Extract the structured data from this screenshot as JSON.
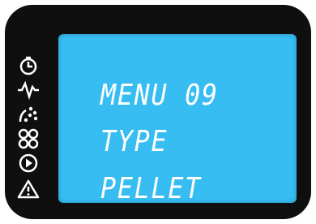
{
  "display": {
    "lines": [
      "MENU 09",
      "TYPE",
      "PELLET"
    ]
  },
  "icons": [
    {
      "name": "clock-icon"
    },
    {
      "name": "heater-icon"
    },
    {
      "name": "pellet-feed-icon"
    },
    {
      "name": "fan-icon"
    },
    {
      "name": "play-icon"
    },
    {
      "name": "alarm-icon"
    }
  ],
  "colors": {
    "bezel": "#0f0f0f",
    "screen": "#37bdf2",
    "text": "#ffffff"
  }
}
